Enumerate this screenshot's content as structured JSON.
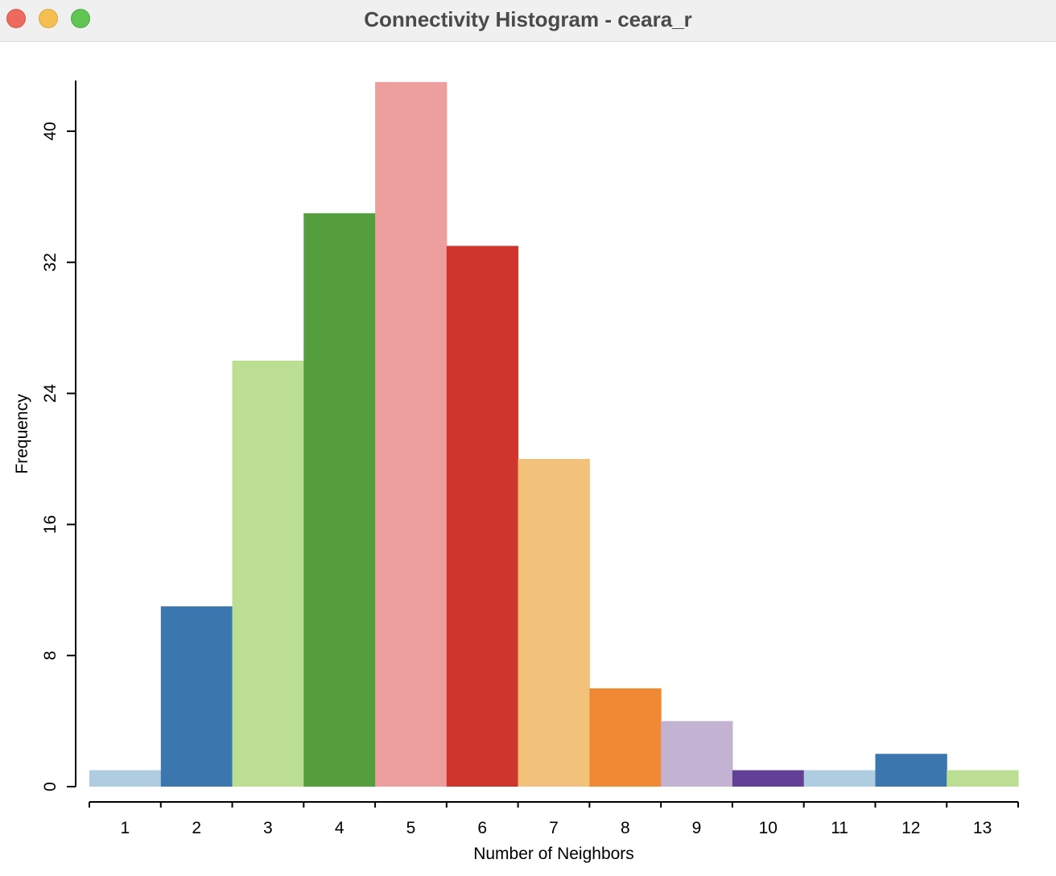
{
  "window": {
    "title": "Connectivity Histogram - ceara_r",
    "controls": {
      "close": "close-button",
      "minimize": "minimize-button",
      "zoom": "zoom-button"
    }
  },
  "chart_data": {
    "type": "bar",
    "title": "Connectivity Histogram - ceara_r",
    "xlabel": "Number of Neighbors",
    "ylabel": "Frequency",
    "categories": [
      "1",
      "2",
      "3",
      "4",
      "5",
      "6",
      "7",
      "8",
      "9",
      "10",
      "11",
      "12",
      "13"
    ],
    "values": [
      1,
      11,
      26,
      35,
      43,
      33,
      20,
      6,
      4,
      1,
      1,
      2,
      1
    ],
    "colors": [
      "#aecde1",
      "#3b77ae",
      "#bcde93",
      "#559e3e",
      "#ec9f9c",
      "#d0352d",
      "#f2c27b",
      "#ef8933",
      "#c4b2d3",
      "#633f95",
      "#aecde1",
      "#3b77ae",
      "#bcde93"
    ],
    "yticks": [
      0,
      8,
      16,
      24,
      32,
      40
    ],
    "ylim": [
      0,
      43
    ],
    "grid": false,
    "legend": "none"
  }
}
